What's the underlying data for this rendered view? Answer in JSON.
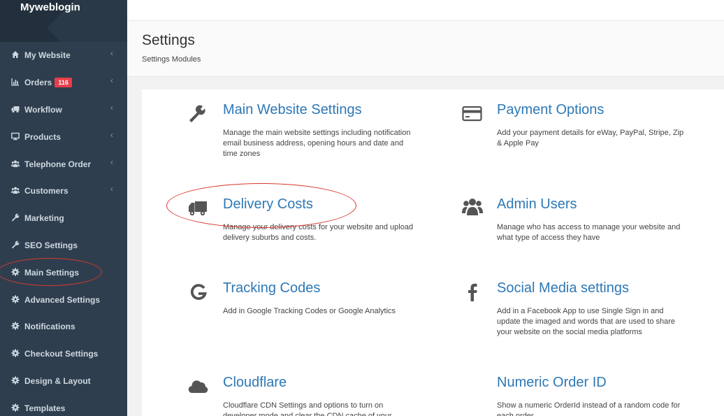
{
  "brand": "Myweblogin",
  "sidebar": {
    "items": [
      {
        "label": "My Website",
        "icon": "home-icon",
        "chevron": "‹"
      },
      {
        "label": "Orders",
        "icon": "bar-chart-icon",
        "chevron": "‹",
        "badge": "116"
      },
      {
        "label": "Workflow",
        "icon": "truck-icon",
        "chevron": "‹"
      },
      {
        "label": "Products",
        "icon": "monitor-icon",
        "chevron": "‹"
      },
      {
        "label": "Telephone Order",
        "icon": "users-icon",
        "chevron": "‹"
      },
      {
        "label": "Customers",
        "icon": "users-icon",
        "chevron": "‹"
      },
      {
        "label": "Marketing",
        "icon": "wrench-icon"
      },
      {
        "label": "SEO Settings",
        "icon": "wrench-icon"
      },
      {
        "label": "Main Settings",
        "icon": "gear-icon"
      },
      {
        "label": "Advanced Settings",
        "icon": "gear-icon"
      },
      {
        "label": "Notifications",
        "icon": "gear-icon"
      },
      {
        "label": "Checkout Settings",
        "icon": "gear-icon"
      },
      {
        "label": "Design & Layout",
        "icon": "gear-icon"
      },
      {
        "label": "Templates",
        "icon": "gear-icon"
      }
    ]
  },
  "header": {
    "title": "Settings",
    "subtitle": "Settings Modules"
  },
  "modules": [
    {
      "title": "Main Website Settings",
      "icon": "wrench-icon",
      "desc": "Manage the main website settings including notification email business address, opening hours and date and time zones"
    },
    {
      "title": "Payment Options",
      "icon": "credit-card-icon",
      "desc": "Add your payment details for eWay, PayPal, Stripe, Zip & Apple Pay"
    },
    {
      "title": "Delivery Costs",
      "icon": "truck-icon",
      "desc": "Manage your delivery costs for your website and upload delivery suburbs and costs."
    },
    {
      "title": "Admin Users",
      "icon": "users-icon",
      "desc": "Manage who has access to manage your website and what type of access they have"
    },
    {
      "title": "Tracking Codes",
      "icon": "google-icon",
      "desc": "Add in Google Tracking Codes or Google Analytics"
    },
    {
      "title": "Social Media settings",
      "icon": "facebook-icon",
      "desc": "Add in a Facebook App to use Single Sign in and update the imaged and words that are used to share your website on the social media platforms"
    },
    {
      "title": "Cloudflare",
      "icon": "cloud-icon",
      "desc": "Cloudflare CDN Settings and options to turn on developer mode and clear the CDN cache of your"
    },
    {
      "title": "Numeric Order ID",
      "icon": "",
      "desc": "Show a numeric OrderId instead of a random code for each order"
    }
  ],
  "colors": {
    "sidebar_bg": "#2e3e4e",
    "link": "#2e78b5",
    "badge": "#e83e4b",
    "annotation": "#d8392b"
  }
}
